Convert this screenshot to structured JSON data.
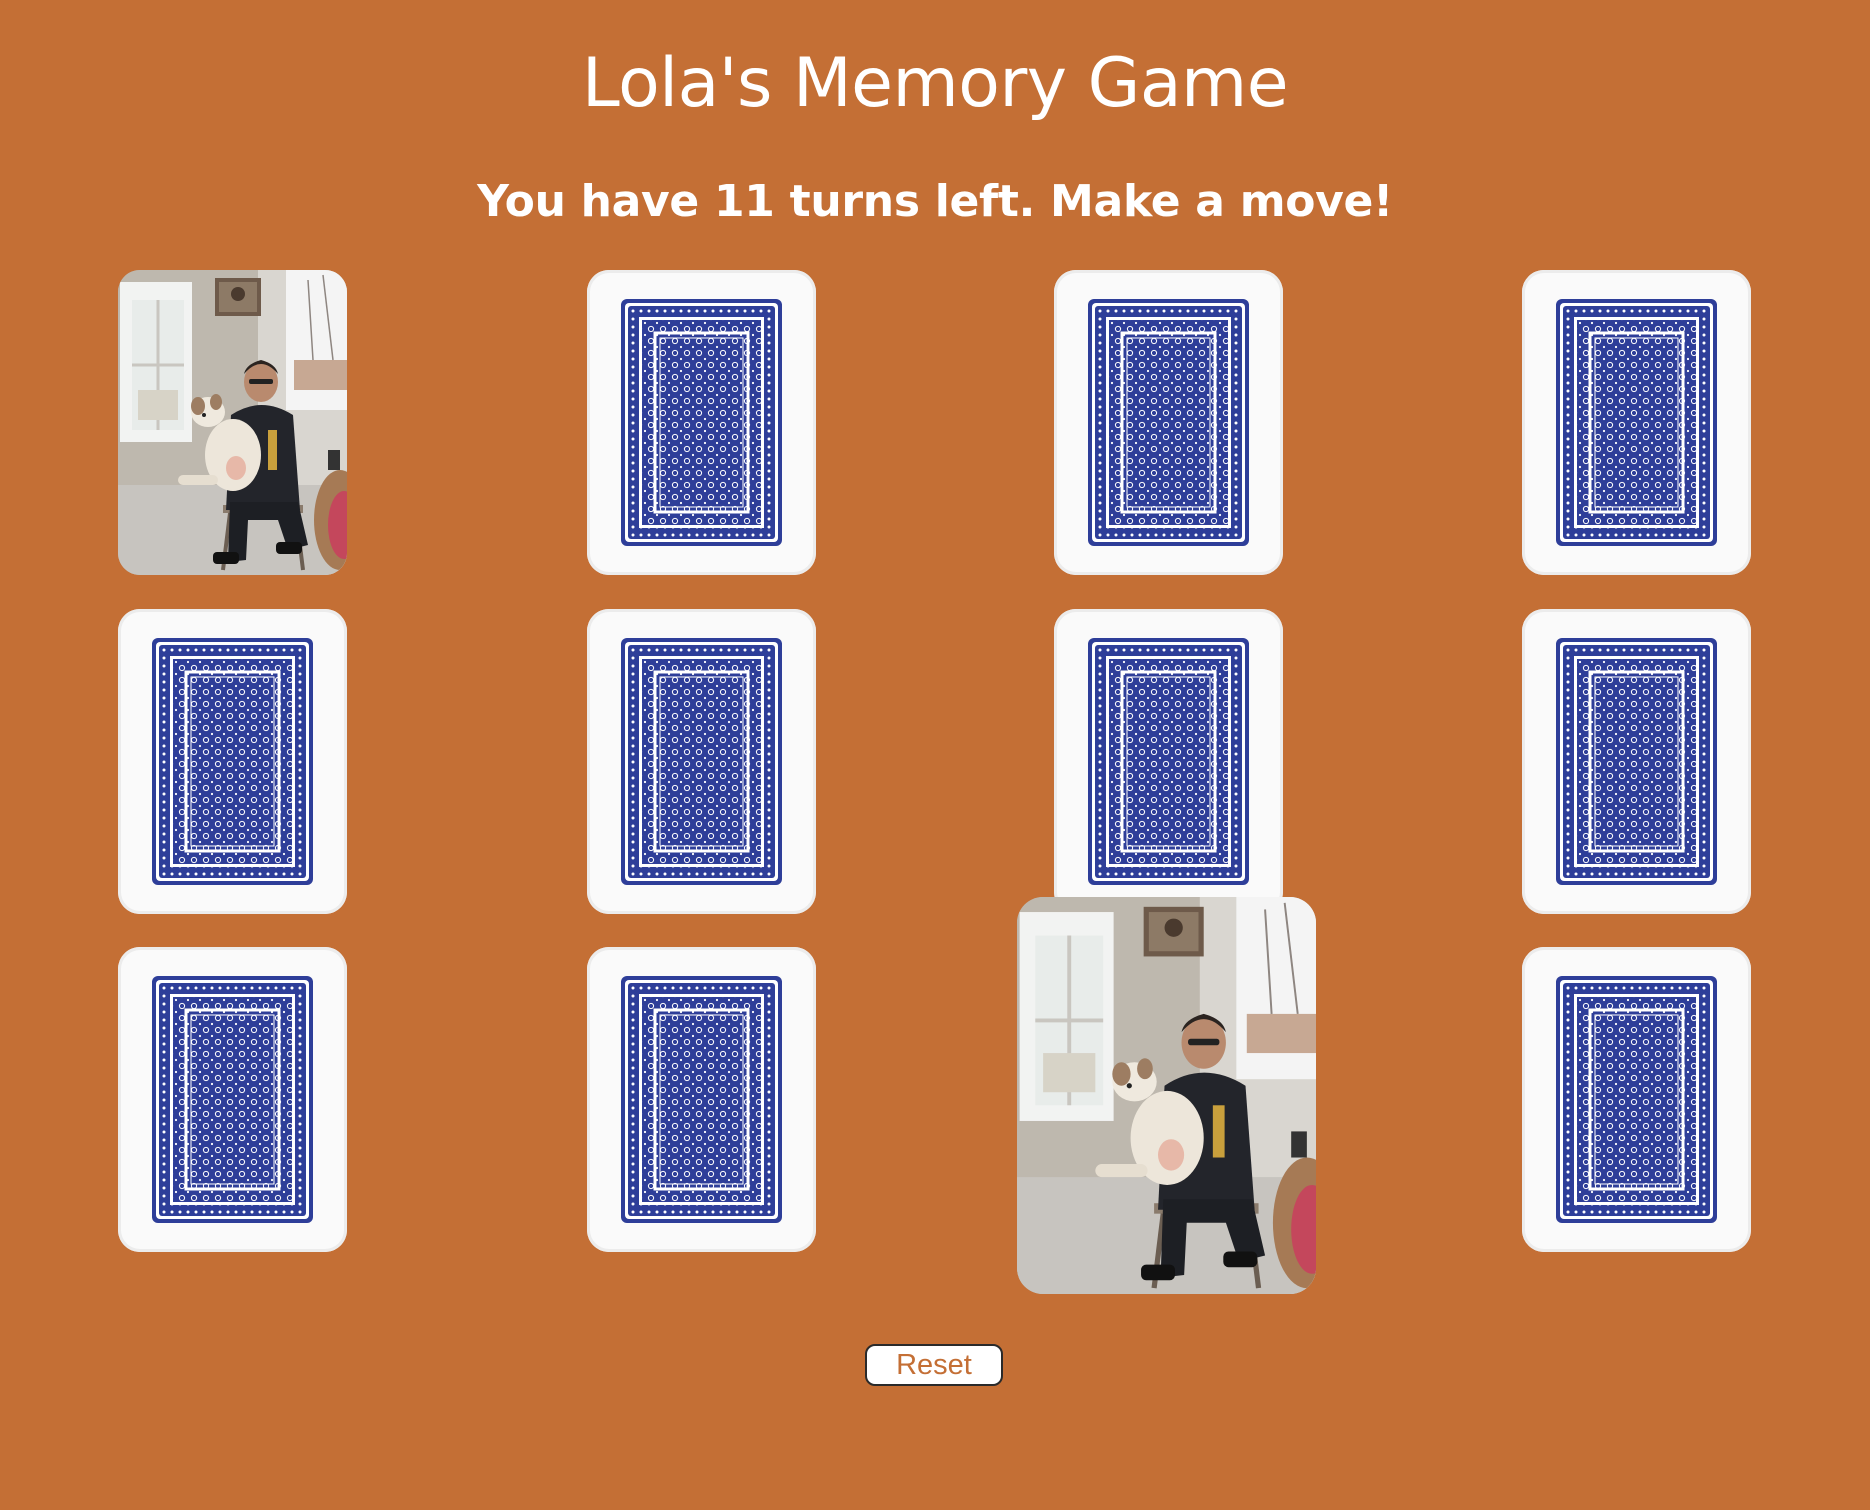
{
  "header": {
    "title": "Lola's Memory Game",
    "status": "You have 11 turns left. Make a move!"
  },
  "colors": {
    "background": "#C46F35",
    "card_back_blue": "#2E3E99",
    "card_back_white": "#FAFAFA",
    "text": "#FFFFFF",
    "reset_text": "#C46F35"
  },
  "board": {
    "rows": 3,
    "columns": 4,
    "cards": [
      {
        "state": "face-up",
        "image": "photo-man-holding-dog"
      },
      {
        "state": "face-down",
        "image": "card-back-pattern"
      },
      {
        "state": "face-down",
        "image": "card-back-pattern"
      },
      {
        "state": "face-down",
        "image": "card-back-pattern"
      },
      {
        "state": "face-down",
        "image": "card-back-pattern"
      },
      {
        "state": "face-down",
        "image": "card-back-pattern"
      },
      {
        "state": "face-down",
        "image": "card-back-pattern"
      },
      {
        "state": "face-down",
        "image": "card-back-pattern"
      },
      {
        "state": "face-down",
        "image": "card-back-pattern"
      },
      {
        "state": "face-down",
        "image": "card-back-pattern"
      },
      {
        "state": "face-up",
        "image": "photo-man-holding-dog"
      },
      {
        "state": "face-down",
        "image": "card-back-pattern"
      }
    ]
  },
  "controls": {
    "reset_label": "Reset"
  }
}
